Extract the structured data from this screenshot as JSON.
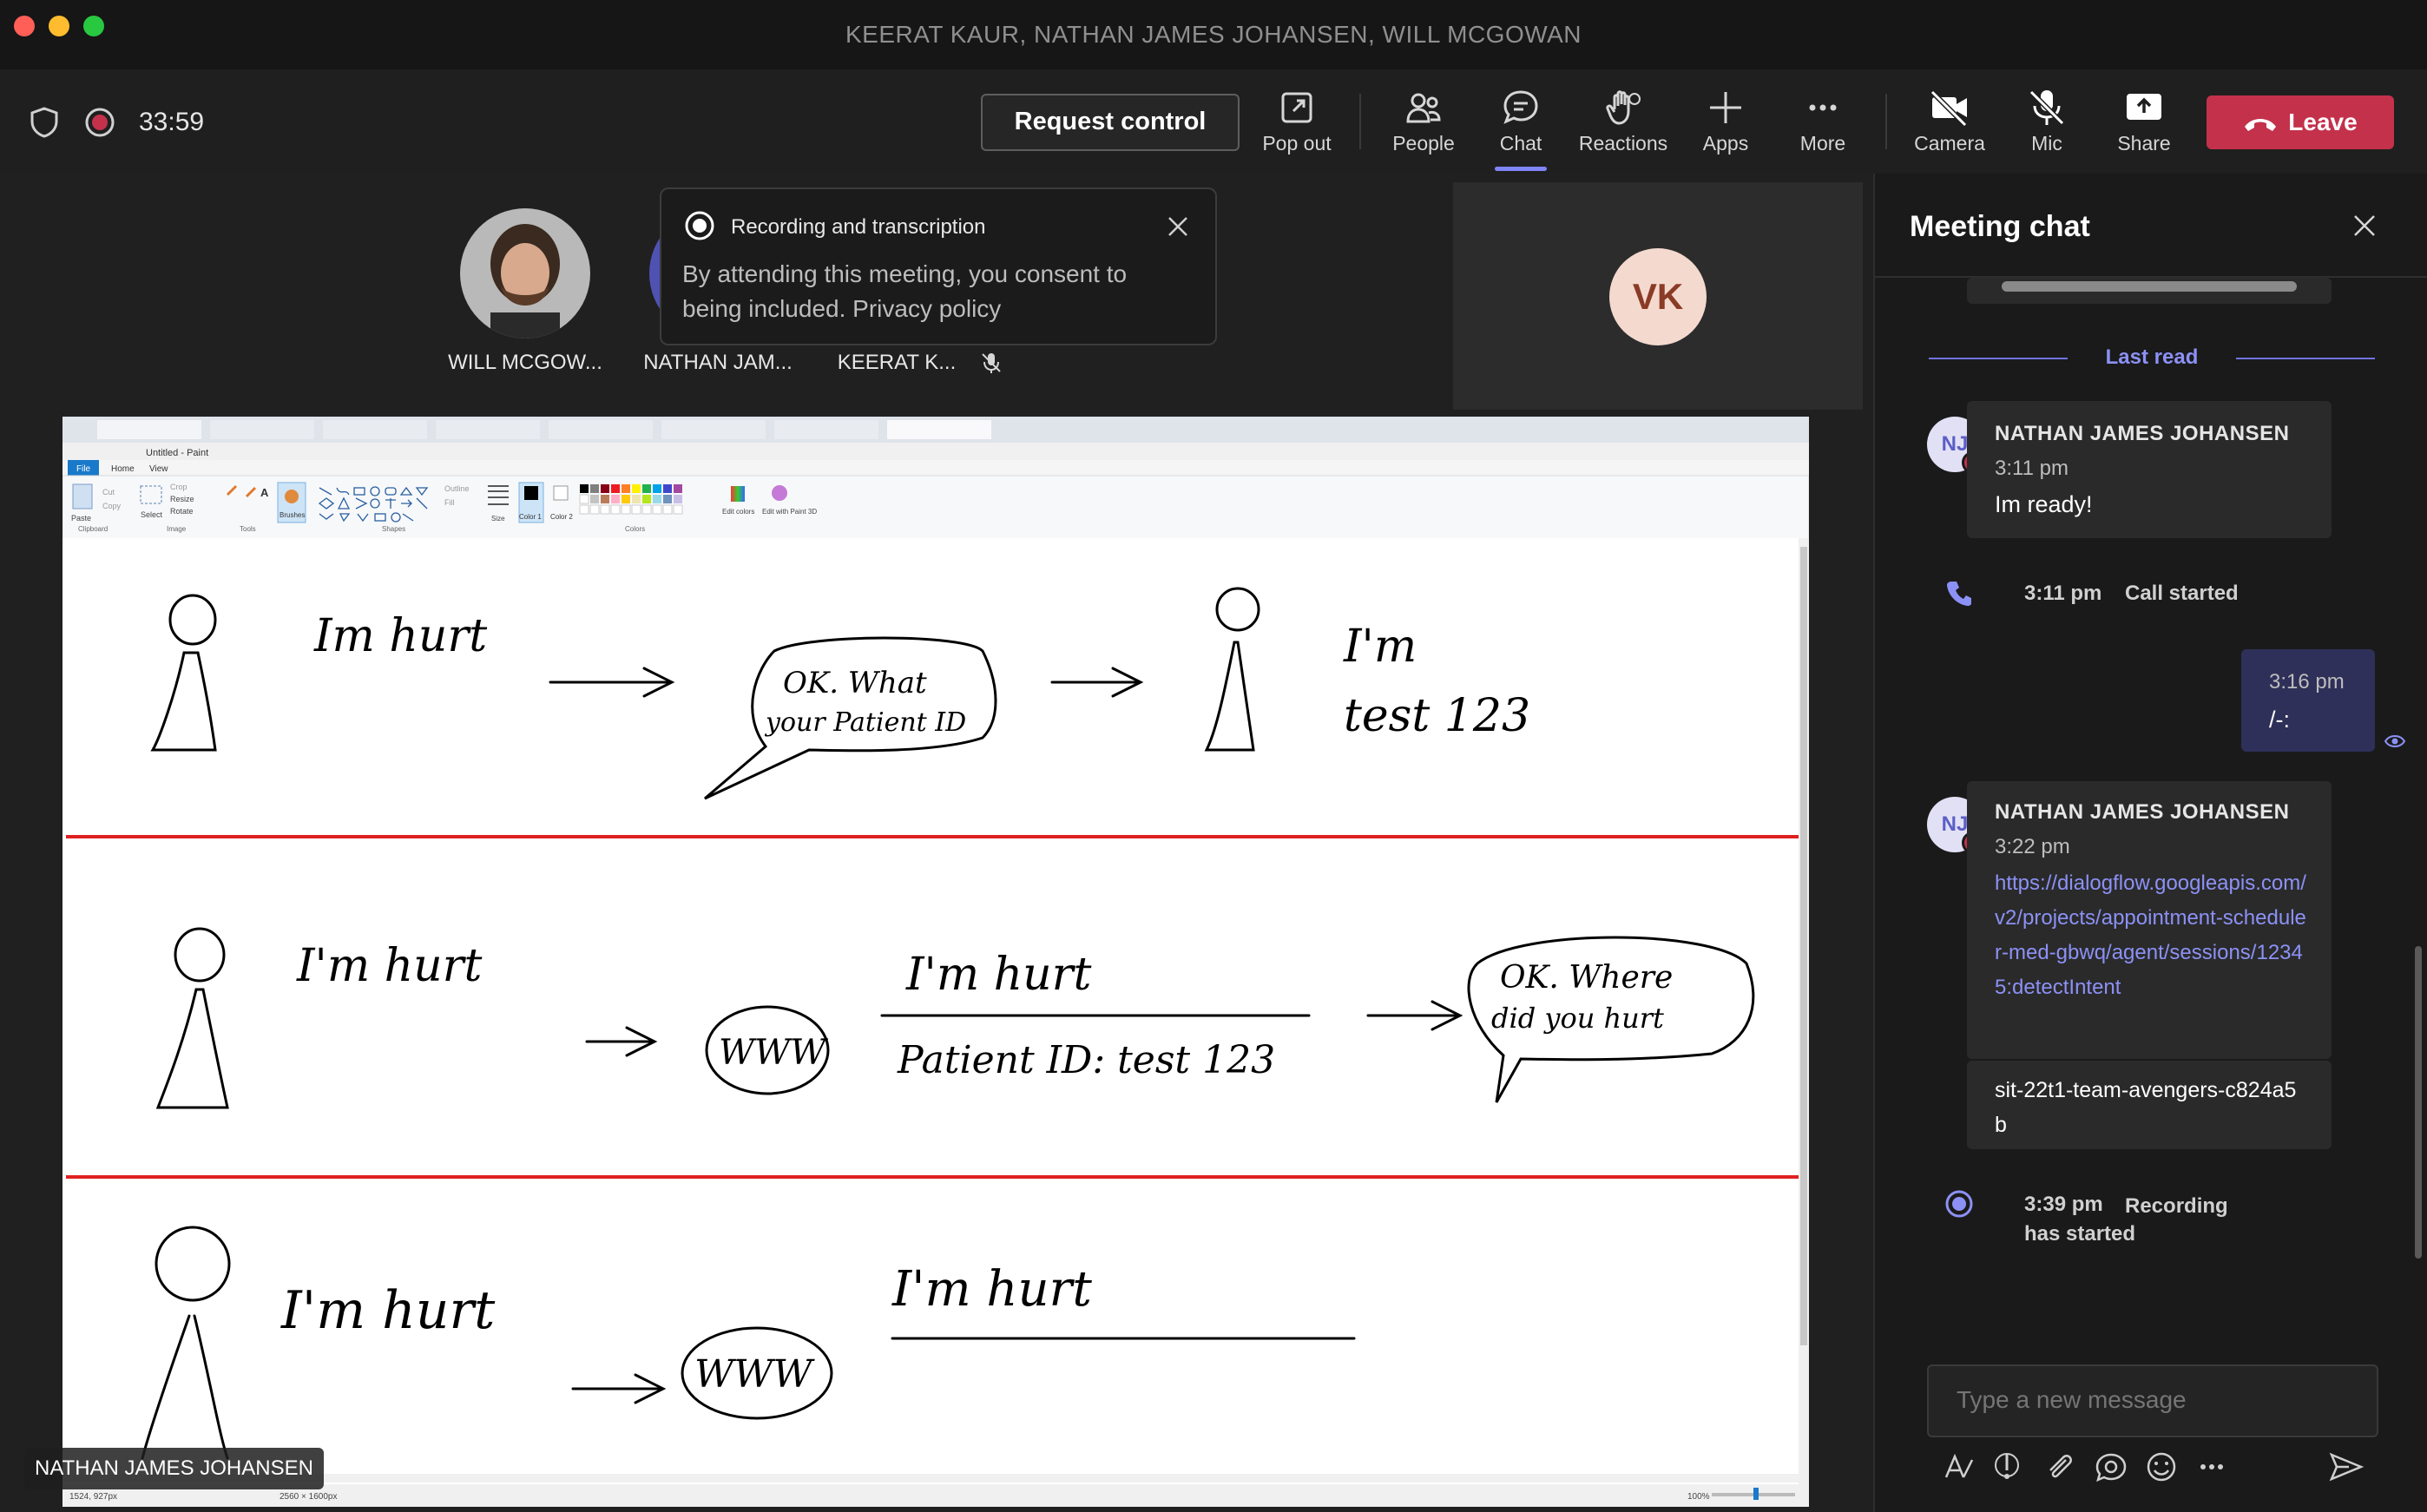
{
  "window": {
    "title": "KEERAT KAUR, NATHAN JAMES JOHANSEN, WILL MCGOWAN"
  },
  "toolbar": {
    "timer": "33:59",
    "request_control": "Request control",
    "pop_out": "Pop out",
    "people": "People",
    "chat": "Chat",
    "reactions": "Reactions",
    "apps": "Apps",
    "more": "More",
    "camera": "Camera",
    "mic": "Mic",
    "share": "Share",
    "leave": "Leave",
    "accent": "#7f85f5",
    "leave_color": "#c4314b"
  },
  "participants": [
    {
      "name": "WILL MCGOW...",
      "icon": "avatar-photo"
    },
    {
      "name": "NATHAN JAM...",
      "icon": "avatar"
    },
    {
      "name": "KEERAT K...",
      "icon": "mic-off-icon"
    }
  ],
  "vk_tile": {
    "initials": "VK"
  },
  "recording_popup": {
    "title": "Recording and transcription",
    "body": "By attending this meeting, you consent to being included. Privacy policy"
  },
  "shared_screen": {
    "presenter": "NATHAN JAMES JOHANSEN",
    "paint": {
      "window_title": "Untitled - Paint",
      "menu_tabs": [
        "File",
        "Home",
        "View"
      ],
      "groups": [
        "Clipboard",
        "Image",
        "Tools",
        "Shapes",
        "Colors"
      ],
      "tools": [
        "Paste",
        "Cut",
        "Copy",
        "Select",
        "Crop",
        "Resize",
        "Rotate",
        "Brushes",
        "Size",
        "Color 1",
        "Color 2",
        "Edit colors",
        "Edit with Paint 3D"
      ],
      "outline": "Outline",
      "fill": "Fill",
      "status_pos": "1524, 927px",
      "status_size": "2560 × 1600px",
      "zoom": "100%"
    },
    "sketch_text": {
      "row1_label": "Im hurt",
      "row1_bubble": [
        "OK. What",
        "your Patient ID"
      ],
      "row1_result": [
        "I'm",
        "test 123"
      ],
      "row2_label": "I'm hurt",
      "row2_cloud": "WWW",
      "row2_top": "I'm hurt",
      "row2_bottom": "Patient ID: test 123",
      "row2_bubble": [
        "OK. Where",
        "did you hurt"
      ],
      "row3_label": "I'm hurt",
      "row3_cloud": "WWW",
      "row3_top": "I'm hurt"
    }
  },
  "chat": {
    "title": "Meeting chat",
    "last_read": "Last read",
    "messages": [
      {
        "initials": "NJ",
        "sender": "NATHAN JAMES JOHANSEN",
        "time": "3:11 pm",
        "text": "Im ready!"
      },
      {
        "event_time": "3:11 pm",
        "event": "Call started"
      },
      {
        "time": "3:16 pm",
        "text": "/-:"
      },
      {
        "initials": "NJ",
        "sender": "NATHAN JAMES JOHANSEN",
        "time": "3:22 pm",
        "link": "https://dialogflow.googleapis.com/v2/projects/appointment-scheduler-med-gbwq/agent/sessions/12345:detectIntent",
        "followup": "sit-22t1-team-avengers-c824a5b"
      },
      {
        "event_time": "3:39 pm",
        "event": "Recording has started"
      }
    ],
    "compose_placeholder": "Type a new message"
  }
}
